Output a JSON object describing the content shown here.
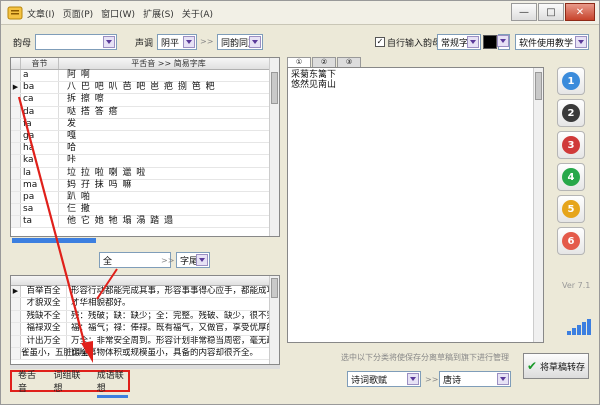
{
  "menu": [
    "文章(I)",
    "页面(P)",
    "窗口(W)",
    "扩展(S)",
    "关于(A)"
  ],
  "window_buttons": [
    "—",
    "□",
    "✕"
  ],
  "toolbar": {
    "rhyme_label": "韵母",
    "rhyme_value": "",
    "tone_label": "声调",
    "tone_value": "阴平",
    "chevrons": ">>",
    "rhyme_table_value": "同韵同声",
    "auto_input_label": "自行输入韵母",
    "auto_input_checked": "✓",
    "font_value": "常规字体",
    "usage_value": "软件使用教学"
  },
  "grid": {
    "headers": [
      "音节",
      "平舌音 >> 简易字库"
    ],
    "rows": [
      {
        "ind": "",
        "syllable": "a",
        "chars": "阿 啊"
      },
      {
        "ind": "▶",
        "syllable": "ba",
        "chars": "八 巴 吧 叭 芭 吧 岜 疤 捌 笆 粑"
      },
      {
        "ind": "",
        "syllable": "ca",
        "chars": "拆 擦 嚓"
      },
      {
        "ind": "",
        "syllable": "da",
        "chars": "哒 搭 答 瘩"
      },
      {
        "ind": "",
        "syllable": "fa",
        "chars": "发"
      },
      {
        "ind": "",
        "syllable": "ga",
        "chars": "嘎"
      },
      {
        "ind": "",
        "syllable": "ha",
        "chars": "哈"
      },
      {
        "ind": "",
        "syllable": "ka",
        "chars": "咔"
      },
      {
        "ind": "",
        "syllable": "la",
        "chars": "垃 拉 啦 喇 邋 啦"
      },
      {
        "ind": "",
        "syllable": "ma",
        "chars": "妈 孖 抹 吗 嘛"
      },
      {
        "ind": "",
        "syllable": "pa",
        "chars": "趴 啪"
      },
      {
        "ind": "",
        "syllable": "sa",
        "chars": "仨 撒"
      },
      {
        "ind": "",
        "syllable": "ta",
        "chars": "他 它 她 牠 塌 溻 踏 遢"
      }
    ]
  },
  "search": {
    "value": "全",
    "chevrons": ">>",
    "position_value": "字尾"
  },
  "grid2": {
    "rows": [
      {
        "ind": "▶",
        "word": "百举百全",
        "def": "形容行动都能完成其事，形容事事得心应手，都能成功。"
      },
      {
        "ind": "",
        "word": "才貌双全",
        "def": "才华相貌都好。"
      },
      {
        "ind": "",
        "word": "残缺不全",
        "def": "残：残破；缺：缺少；全：完整。残破、缺少，很不完整。"
      },
      {
        "ind": "",
        "word": "福禄双全",
        "def": "福：福气；禄：俸禄。既有福气，又做官，享受优厚的俸禄。"
      },
      {
        "ind": "",
        "word": "计出万全",
        "def": "万全：非常安全周到。形容计划非常稳当周密，毫无疏漏。"
      },
      {
        "ind": "",
        "word": "雀虽小，五脏俱全",
        "def": "比喻事物体积或规模虽小，具备的内容却很齐全。"
      }
    ]
  },
  "bottom_tabs": [
    "卷舌音",
    "词组联想",
    "成语联想"
  ],
  "right_tabs": [
    "①",
    "②",
    "③"
  ],
  "editor_lines": [
    "采菊东篱下",
    "悠然见南山"
  ],
  "hint": "选中以下分类将使保存分离草稿到旗下进行管理",
  "bottom_right": {
    "category_value": "诗词歌赋",
    "chevrons": ">>",
    "subcategory_value": "唐诗",
    "commit_label": "将草稿转存"
  },
  "side_buttons": [
    {
      "label": "1",
      "color": "#3a8bdb"
    },
    {
      "label": "2",
      "color": "#3a3a3a"
    },
    {
      "label": "3",
      "color": "#d03a3a"
    },
    {
      "label": "4",
      "color": "#27a84a"
    },
    {
      "label": "5",
      "color": "#e6a51c"
    },
    {
      "label": "6",
      "color": "#e45a4a"
    }
  ],
  "version": "Ver 7.1",
  "colors": {
    "accent": "#3c7fe0",
    "highlight_red": "#e0201a"
  }
}
